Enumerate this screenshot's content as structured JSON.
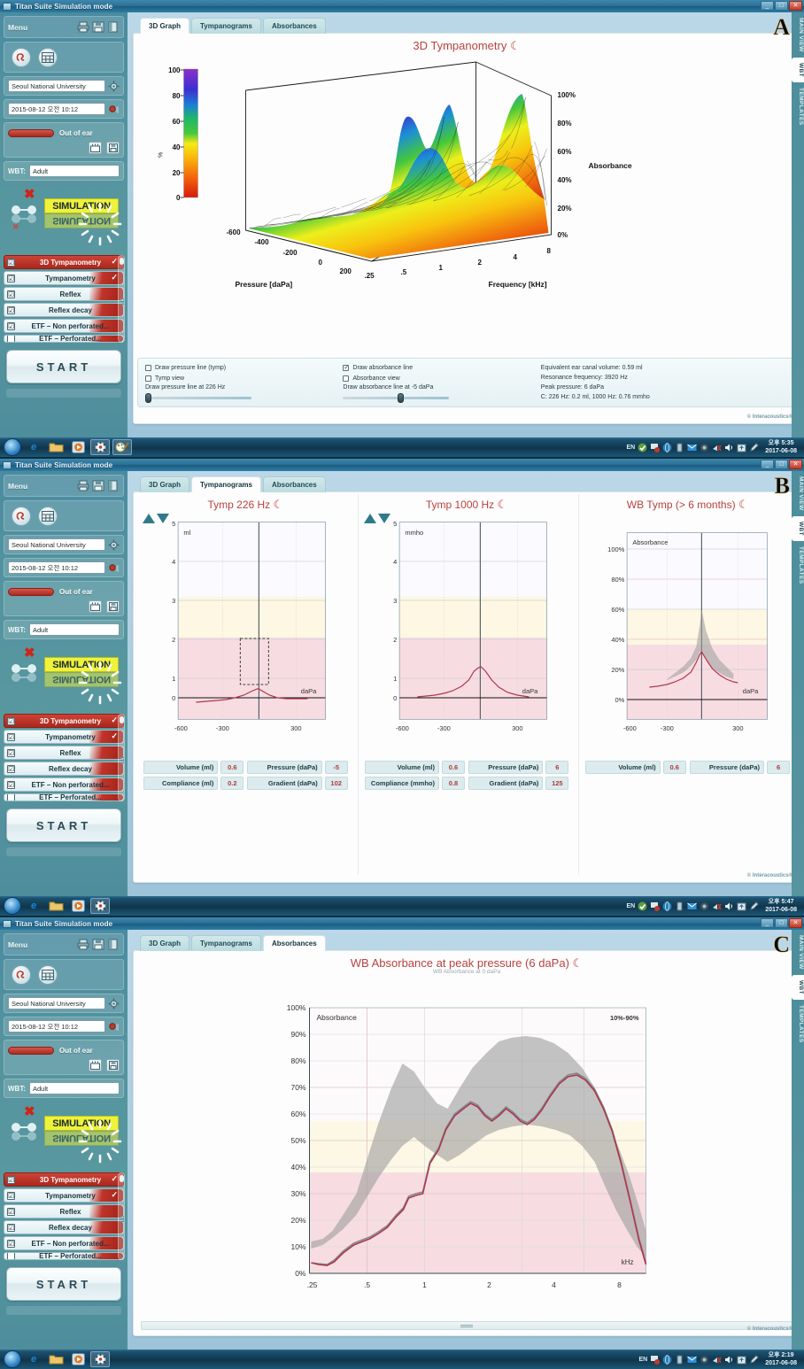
{
  "app": {
    "title": "Titan Suite Simulation mode",
    "copyright": "© Interacoustics®",
    "copyright_shadow": "© Interacoustics®"
  },
  "sidebar": {
    "menu_label": "Menu",
    "icons": [
      "print-icon",
      "save-icon",
      "exit-icon"
    ],
    "tool_icons": [
      "ear-probe-icon",
      "grid-icon"
    ],
    "clinic": "Seoul National University",
    "datetime": "2015-08-12 오전 10:12",
    "ear_status": "Out of ear",
    "wbt_label": "WBT:",
    "wbt_value": "Adult",
    "simulation_text": "SIMULATION",
    "tests": [
      {
        "label": "3D Tympanometry",
        "checked": true,
        "active": true,
        "done": true
      },
      {
        "label": "Tympanometry",
        "checked": true,
        "active": false,
        "done": true
      },
      {
        "label": "Reflex",
        "checked": true,
        "active": false,
        "done": false
      },
      {
        "label": "Reflex decay",
        "checked": true,
        "active": false,
        "done": false
      },
      {
        "label": "ETF – Non perforated...",
        "checked": true,
        "active": false,
        "done": false
      },
      {
        "label": "ETF – Perforated...",
        "checked": true,
        "active": false,
        "done": false
      }
    ],
    "start_button": "START"
  },
  "tabs": [
    {
      "label": "3D Graph"
    },
    {
      "label": "Tympanograms"
    },
    {
      "label": "Absorbances"
    }
  ],
  "vtabs": [
    "MAIN VIEW",
    "WBT",
    "TEMPLATES"
  ],
  "panels": {
    "a": {
      "letter": "A",
      "active_tab": "3D Graph",
      "chart_title": "3D Tympanometry",
      "options": {
        "draw_pressure_line": {
          "label": "Draw pressure line (tymp)",
          "checked": false
        },
        "tymp_view": {
          "label": "Tymp view",
          "checked": false
        },
        "pressure_caption": "Draw pressure line at 226 Hz",
        "draw_absorbance_line": {
          "label": "Draw absorbance line",
          "checked": true
        },
        "absorbance_view": {
          "label": "Absorbance view",
          "checked": false
        },
        "absorbance_caption": "Draw absorbance line at -5 daPa"
      },
      "results": [
        "Equivalent ear canal volume: 0.59 ml",
        "Resonance frequency: 3920 Hz",
        "Peak pressure: 6 daPa",
        "C: 226 Hz: 0.2 ml, 1000 Hz: 0.76 mmho"
      ],
      "taskbar_time": "오후 5:35",
      "taskbar_date": "2017-06-08"
    },
    "b": {
      "letter": "B",
      "active_tab": "Tympanograms",
      "taskbar_time": "오후 5:47",
      "taskbar_date": "2017-06-08",
      "charts": [
        {
          "title": "Tymp 226 Hz",
          "unit": "ml",
          "values": [
            {
              "label": "Volume (ml)",
              "value": "0.6"
            },
            {
              "label": "Pressure (daPa)",
              "value": "-5"
            },
            {
              "label": "Compliance (ml)",
              "value": "0.2"
            },
            {
              "label": "Gradient (daPa)",
              "value": "102"
            }
          ]
        },
        {
          "title": "Tymp 1000 Hz",
          "unit": "mmho",
          "values": [
            {
              "label": "Volume (ml)",
              "value": "0.6"
            },
            {
              "label": "Pressure (daPa)",
              "value": "6"
            },
            {
              "label": "Compliance (mmho)",
              "value": "0.8"
            },
            {
              "label": "Gradient (daPa)",
              "value": "125"
            }
          ]
        },
        {
          "title": "WB Tymp (> 6 months)",
          "unit": "Absorbance",
          "values": [
            {
              "label": "Volume (ml)",
              "value": "0.6"
            },
            {
              "label": "Pressure (daPa)",
              "value": "6"
            }
          ]
        }
      ]
    },
    "c": {
      "letter": "C",
      "active_tab": "Absorbances",
      "chart_title": "WB Absorbance at peak pressure (6 daPa)",
      "chart_subtitle": "WB Absorbance at 0 daPa",
      "legend": "10%-90%",
      "taskbar_time": "오후 2:19",
      "taskbar_date": "2017-06-08"
    }
  },
  "chart_data": [
    {
      "type": "surface",
      "title": "3D Tympanometry",
      "xlabel": "Pressure [daPa]",
      "ylabel": "Frequency [kHz]",
      "zlabel": "Absorbance",
      "colorbar_label": "%",
      "colorbar_ticks": [
        "0",
        "20",
        "40",
        "60",
        "80",
        "100"
      ],
      "x_ticks": [
        "-600",
        "-400",
        "-200",
        "0",
        "200"
      ],
      "y_ticks": [
        ".25",
        ".5",
        "1",
        "2",
        "4",
        "8"
      ],
      "z_ticks": [
        "0%",
        "20%",
        "40%",
        "60%",
        "80%",
        "100%"
      ],
      "zlim": [
        0,
        100
      ]
    },
    {
      "type": "line",
      "title": "Tymp 226 Hz",
      "ylabel": "ml",
      "xlabel": "daPa",
      "x_ticks": [
        "-600",
        "-300",
        "300"
      ],
      "y_ticks": [
        "0",
        "1",
        "2",
        "3",
        "4",
        "5"
      ],
      "ylim": [
        0,
        5
      ],
      "xlim": [
        -600,
        400
      ],
      "peak": {
        "pressure": -5,
        "compliance": 0.2
      },
      "normal_box": {
        "x0": -120,
        "x1": 30,
        "y0": 0.5,
        "y1": 2.0
      },
      "x": [
        -500,
        -450,
        -400,
        -350,
        -300,
        -250,
        -200,
        -150,
        -100,
        -60,
        -30,
        -5,
        20,
        50,
        90,
        140,
        200,
        260,
        320
      ],
      "y": [
        -0.12,
        -0.11,
        -0.1,
        -0.09,
        -0.07,
        -0.05,
        -0.02,
        0.01,
        0.05,
        0.11,
        0.17,
        0.22,
        0.17,
        0.11,
        0.06,
        0.02,
        0.0,
        -0.01,
        -0.01
      ]
    },
    {
      "type": "line",
      "title": "Tymp 1000 Hz",
      "ylabel": "mmho",
      "xlabel": "daPa",
      "x_ticks": [
        "-600",
        "-300",
        "300"
      ],
      "y_ticks": [
        "0",
        "1",
        "2",
        "3",
        "4",
        "5"
      ],
      "ylim": [
        0,
        5
      ],
      "xlim": [
        -600,
        400
      ],
      "peak": {
        "pressure": 6,
        "compliance": 0.8
      },
      "x": [
        -500,
        -440,
        -380,
        -320,
        -260,
        -200,
        -150,
        -110,
        -70,
        -40,
        -15,
        6,
        30,
        60,
        100,
        150,
        210,
        280,
        340
      ],
      "y": [
        0.02,
        0.03,
        0.04,
        0.06,
        0.08,
        0.12,
        0.18,
        0.26,
        0.42,
        0.6,
        0.75,
        0.8,
        0.72,
        0.55,
        0.35,
        0.18,
        0.08,
        0.04,
        0.02
      ]
    },
    {
      "type": "line",
      "title": "WB Tymp (> 6 months)",
      "ylabel": "Absorbance",
      "xlabel": "daPa",
      "x_ticks": [
        "-600",
        "-300",
        "300"
      ],
      "y_ticks": [
        "0%",
        "20%",
        "40%",
        "60%",
        "80%",
        "100%"
      ],
      "ylim": [
        0,
        110
      ],
      "xlim": [
        -600,
        400
      ],
      "x": [
        -420,
        -380,
        -330,
        -280,
        -230,
        -180,
        -140,
        -100,
        -60,
        -25,
        6,
        40,
        80,
        130,
        180,
        220
      ],
      "y": [
        8,
        8.5,
        9.5,
        11,
        13,
        16,
        19,
        23,
        27,
        31,
        33,
        28,
        23,
        19,
        16,
        14
      ],
      "norm_upper_x": [
        -300,
        -250,
        -200,
        -150,
        -100,
        -50,
        -10,
        6,
        40,
        90,
        150,
        210
      ],
      "norm_upper_y": [
        22,
        25,
        28,
        32,
        38,
        48,
        58,
        60,
        45,
        34,
        27,
        22
      ],
      "norm_lower_x": [
        -300,
        -250,
        -200,
        -150,
        -100,
        -50,
        -10,
        6,
        40,
        90,
        150,
        210
      ],
      "norm_lower_y": [
        13,
        15,
        17,
        19,
        22,
        27,
        31,
        33,
        27,
        22,
        18,
        16
      ]
    },
    {
      "type": "line",
      "title": "WB Absorbance at peak pressure (6 daPa)",
      "subtitle": "WB Absorbance at 0 daPa",
      "ylabel": "Absorbance",
      "xlabel": "kHz",
      "x_ticks": [
        ".25",
        ".5",
        "1",
        "2",
        "4",
        "8"
      ],
      "y_ticks": [
        "0%",
        "10%",
        "20%",
        "30%",
        "40%",
        "50%",
        "60%",
        "70%",
        "80%",
        "90%",
        "100%"
      ],
      "ylim": [
        0,
        100
      ],
      "legend": "10%-90%",
      "series": [
        {
          "name": "WB Absorbance at peak pressure (6 daPa)",
          "x": [
            0.25,
            0.3,
            0.35,
            0.4,
            0.5,
            0.6,
            0.7,
            0.8,
            0.9,
            1.0,
            1.1,
            1.25,
            1.4,
            1.6,
            1.8,
            2.0,
            2.2,
            2.5,
            2.8,
            3.2,
            3.6,
            4.0,
            4.5,
            5.0,
            5.6,
            6.3,
            7.1,
            8.0
          ],
          "y": [
            4,
            3.5,
            5,
            9,
            12,
            16,
            19,
            23,
            29,
            30,
            45,
            57,
            61,
            72,
            76,
            67,
            60,
            58,
            63,
            72,
            78,
            78,
            72,
            62,
            48,
            32,
            17,
            4
          ]
        },
        {
          "name": "WB Absorbance at 0 daPa",
          "x": [
            0.25,
            0.3,
            0.35,
            0.4,
            0.5,
            0.6,
            0.7,
            0.8,
            0.9,
            1.0,
            1.1,
            1.25,
            1.4,
            1.6,
            1.8,
            2.0,
            2.2,
            2.5,
            2.8,
            3.2,
            3.6,
            4.0,
            4.5,
            5.0,
            5.6,
            6.3,
            7.1,
            8.0
          ],
          "y": [
            4,
            3.6,
            5.2,
            9.4,
            12.5,
            16.5,
            19.5,
            24,
            30,
            31,
            46,
            58,
            62,
            73,
            75,
            66,
            59,
            57,
            62,
            71,
            77,
            77,
            71,
            61,
            47,
            31,
            16,
            4
          ]
        }
      ],
      "band_upper": [
        12,
        13,
        16,
        22,
        30,
        44,
        58,
        72,
        79,
        76,
        70,
        63,
        62,
        70,
        81,
        87,
        89,
        89,
        88,
        86,
        82,
        77,
        70,
        60,
        47,
        33,
        22,
        16
      ],
      "band_lower": [
        2,
        2,
        3,
        5,
        8,
        12,
        17,
        22,
        26,
        28,
        34,
        40,
        44,
        50,
        55,
        54,
        50,
        48,
        52,
        57,
        58,
        55,
        47,
        36,
        24,
        14,
        8,
        4
      ]
    }
  ],
  "taskbar": {
    "apps": [
      "start-orb",
      "ie-icon",
      "explorer-icon",
      "media-player-icon",
      "titan-suite-icon",
      "paint-icon"
    ],
    "lang": "EN"
  }
}
